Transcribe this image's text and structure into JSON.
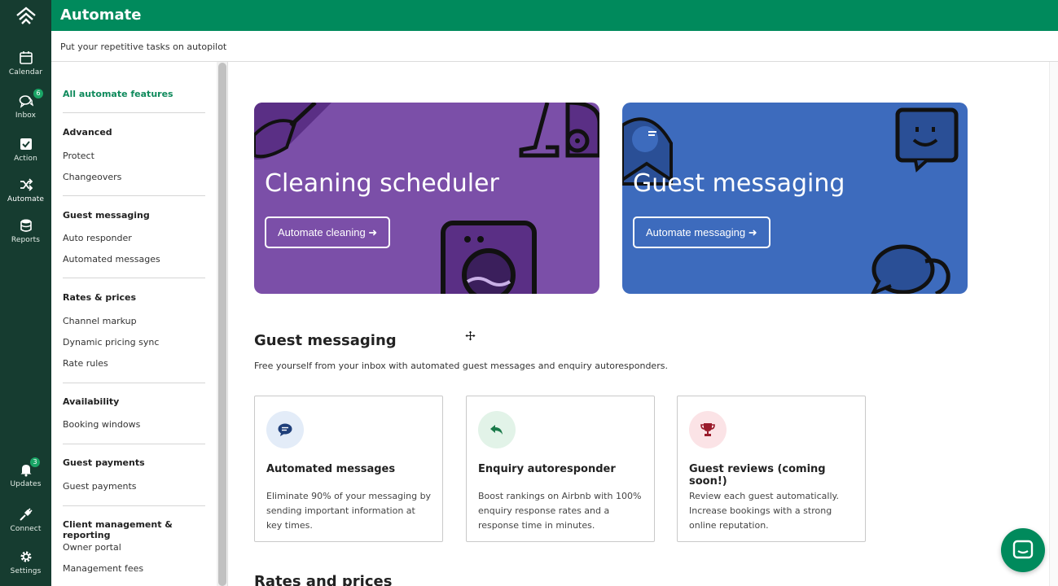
{
  "app": {
    "title": "Automate",
    "subtitle": "Put your repetitive tasks on autopilot"
  },
  "rail": {
    "items": [
      {
        "label": "Calendar",
        "icon": "calendar-icon"
      },
      {
        "label": "Inbox",
        "icon": "chat-icon",
        "badge": "6"
      },
      {
        "label": "Action",
        "icon": "checkbox-icon"
      },
      {
        "label": "Automate",
        "icon": "shuffle-icon"
      },
      {
        "label": "Reports",
        "icon": "database-icon"
      },
      {
        "label": "Updates",
        "icon": "bell-icon",
        "badge": "3"
      },
      {
        "label": "Connect",
        "icon": "plug-icon"
      },
      {
        "label": "Settings",
        "icon": "gear-icon"
      }
    ]
  },
  "menu": {
    "all": "All automate features",
    "groups": [
      {
        "heading": "Advanced",
        "links": [
          "Protect",
          "Changeovers"
        ]
      },
      {
        "heading": "Guest messaging",
        "links": [
          "Auto responder",
          "Automated messages"
        ]
      },
      {
        "heading": "Rates & prices",
        "links": [
          "Channel markup",
          "Dynamic pricing sync",
          "Rate rules"
        ]
      },
      {
        "heading": "Availability",
        "links": [
          "Booking windows"
        ]
      },
      {
        "heading": "Guest payments",
        "links": [
          "Guest payments"
        ]
      },
      {
        "heading": "Client management & reporting",
        "links": [
          "Owner portal",
          "Management fees"
        ]
      }
    ]
  },
  "heroes": [
    {
      "title": "Cleaning scheduler",
      "button": "Automate cleaning ➜",
      "color": "#7b4fa8"
    },
    {
      "title": "Guest messaging",
      "button": "Automate messaging ➜",
      "color": "#3d6bbd"
    }
  ],
  "section": {
    "title": "Guest messaging",
    "description": "Free yourself from your inbox with automated guest messages and enquiry autoresponders."
  },
  "cards": [
    {
      "title": "Automated messages",
      "description": "Eliminate 90% of your messaging by sending important information at key times.",
      "icon": "message-bubble-icon",
      "circle": "#e3ecf8",
      "accent": "#1f3f7a"
    },
    {
      "title": "Enquiry autoresponder",
      "description": "Boost rankings on Airbnb with 100% enquiry response rates and a response time in minutes.",
      "icon": "reply-icon",
      "circle": "#e2f3e8",
      "accent": "#1b7a4a"
    },
    {
      "title": "Guest reviews (coming soon!)",
      "description": "Review each guest automatically. Increase bookings with a strong online reputation.",
      "icon": "trophy-icon",
      "circle": "#fbe3e6",
      "accent": "#9a1b2b"
    }
  ],
  "next_section": {
    "title": "Rates and prices"
  }
}
